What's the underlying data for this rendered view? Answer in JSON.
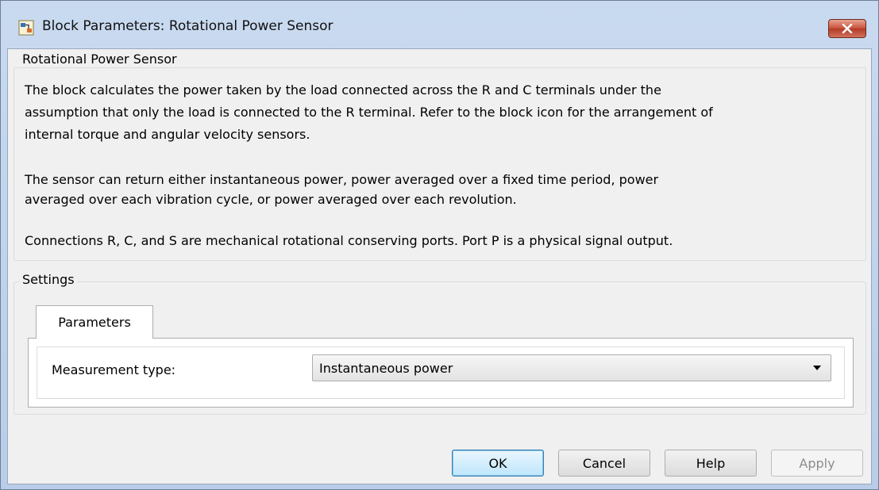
{
  "window": {
    "title": "Block Parameters: Rotational Power Sensor",
    "icon": "simulink-block-icon",
    "close_icon": "close-icon"
  },
  "description": {
    "group_title": "Rotational Power Sensor",
    "paragraph1_line1": "The block calculates the power taken by the load connected across the R and C terminals under the",
    "paragraph1_line2": "assumption that only the load is connected to the R terminal. Refer to the block icon for the arrangement of",
    "paragraph1_line3": "internal torque and angular velocity sensors.",
    "paragraph2_line1": "The sensor can return either instantaneous power, power averaged over a fixed time period, power",
    "paragraph2_line2": "averaged over each vibration cycle, or power averaged over each revolution.",
    "paragraph3_line1": "Connections R, C, and S are mechanical rotational conserving ports.  Port P is a physical signal output."
  },
  "settings": {
    "group_title": "Settings",
    "tabs": [
      {
        "label": "Parameters",
        "active": true
      }
    ],
    "measurement_type": {
      "label": "Measurement type:",
      "value": "Instantaneous power"
    }
  },
  "buttons": {
    "ok": "OK",
    "cancel": "Cancel",
    "help": "Help",
    "apply": "Apply"
  },
  "colors": {
    "titlebar": "#c9daf0",
    "close_button": "#c7503a",
    "default_button_border": "#3c7fb1",
    "dialog_background": "#f0f0f0"
  }
}
